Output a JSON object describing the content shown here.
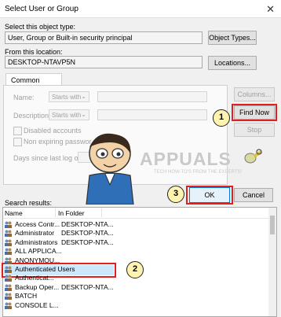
{
  "window": {
    "title": "Select User or Group",
    "close_glyph": "✕"
  },
  "object_type": {
    "label": "Select this object type:",
    "value": "User, Group or Built-in security principal",
    "button": "Object Types..."
  },
  "location": {
    "label": "From this location:",
    "value": "DESKTOP-NTAVP5N",
    "button": "Locations..."
  },
  "common_queries": {
    "tab": "Common Queries",
    "name_label": "Name:",
    "description_label": "Description:",
    "starts_with": "Starts with",
    "disabled_accounts": "Disabled accounts",
    "non_expiring": "Non expiring passwor",
    "days_since": "Days since last log on"
  },
  "side_buttons": {
    "columns": "Columns...",
    "find_now": "Find Now",
    "stop": "Stop"
  },
  "watermark": {
    "brand": "APPUALS",
    "tagline": "TECH HOW-TO'S FROM THE EXPERTS!"
  },
  "actions": {
    "ok": "OK",
    "cancel": "Cancel"
  },
  "results": {
    "label": "Search results:",
    "columns": [
      "Name",
      "In Folder"
    ],
    "rows": [
      {
        "name": "Access Contr...",
        "folder": "DESKTOP-NTA..."
      },
      {
        "name": "Administrator",
        "folder": "DESKTOP-NTA..."
      },
      {
        "name": "Administrators",
        "folder": "DESKTOP-NTA..."
      },
      {
        "name": "ALL APPLICA...",
        "folder": ""
      },
      {
        "name": "ANONYMOU...",
        "folder": ""
      },
      {
        "name": "Authenticated Users",
        "folder": ""
      },
      {
        "name": "Authenticat...",
        "folder": ""
      },
      {
        "name": "Backup Oper...",
        "folder": "DESKTOP-NTA..."
      },
      {
        "name": "BATCH",
        "folder": ""
      },
      {
        "name": "CONSOLE L...",
        "folder": ""
      }
    ]
  },
  "annotations": {
    "step1": "1",
    "step2": "2",
    "step3": "3"
  },
  "colors": {
    "highlight": "#e02020",
    "selection": "#cce8ff",
    "accent": "#0078d7"
  }
}
